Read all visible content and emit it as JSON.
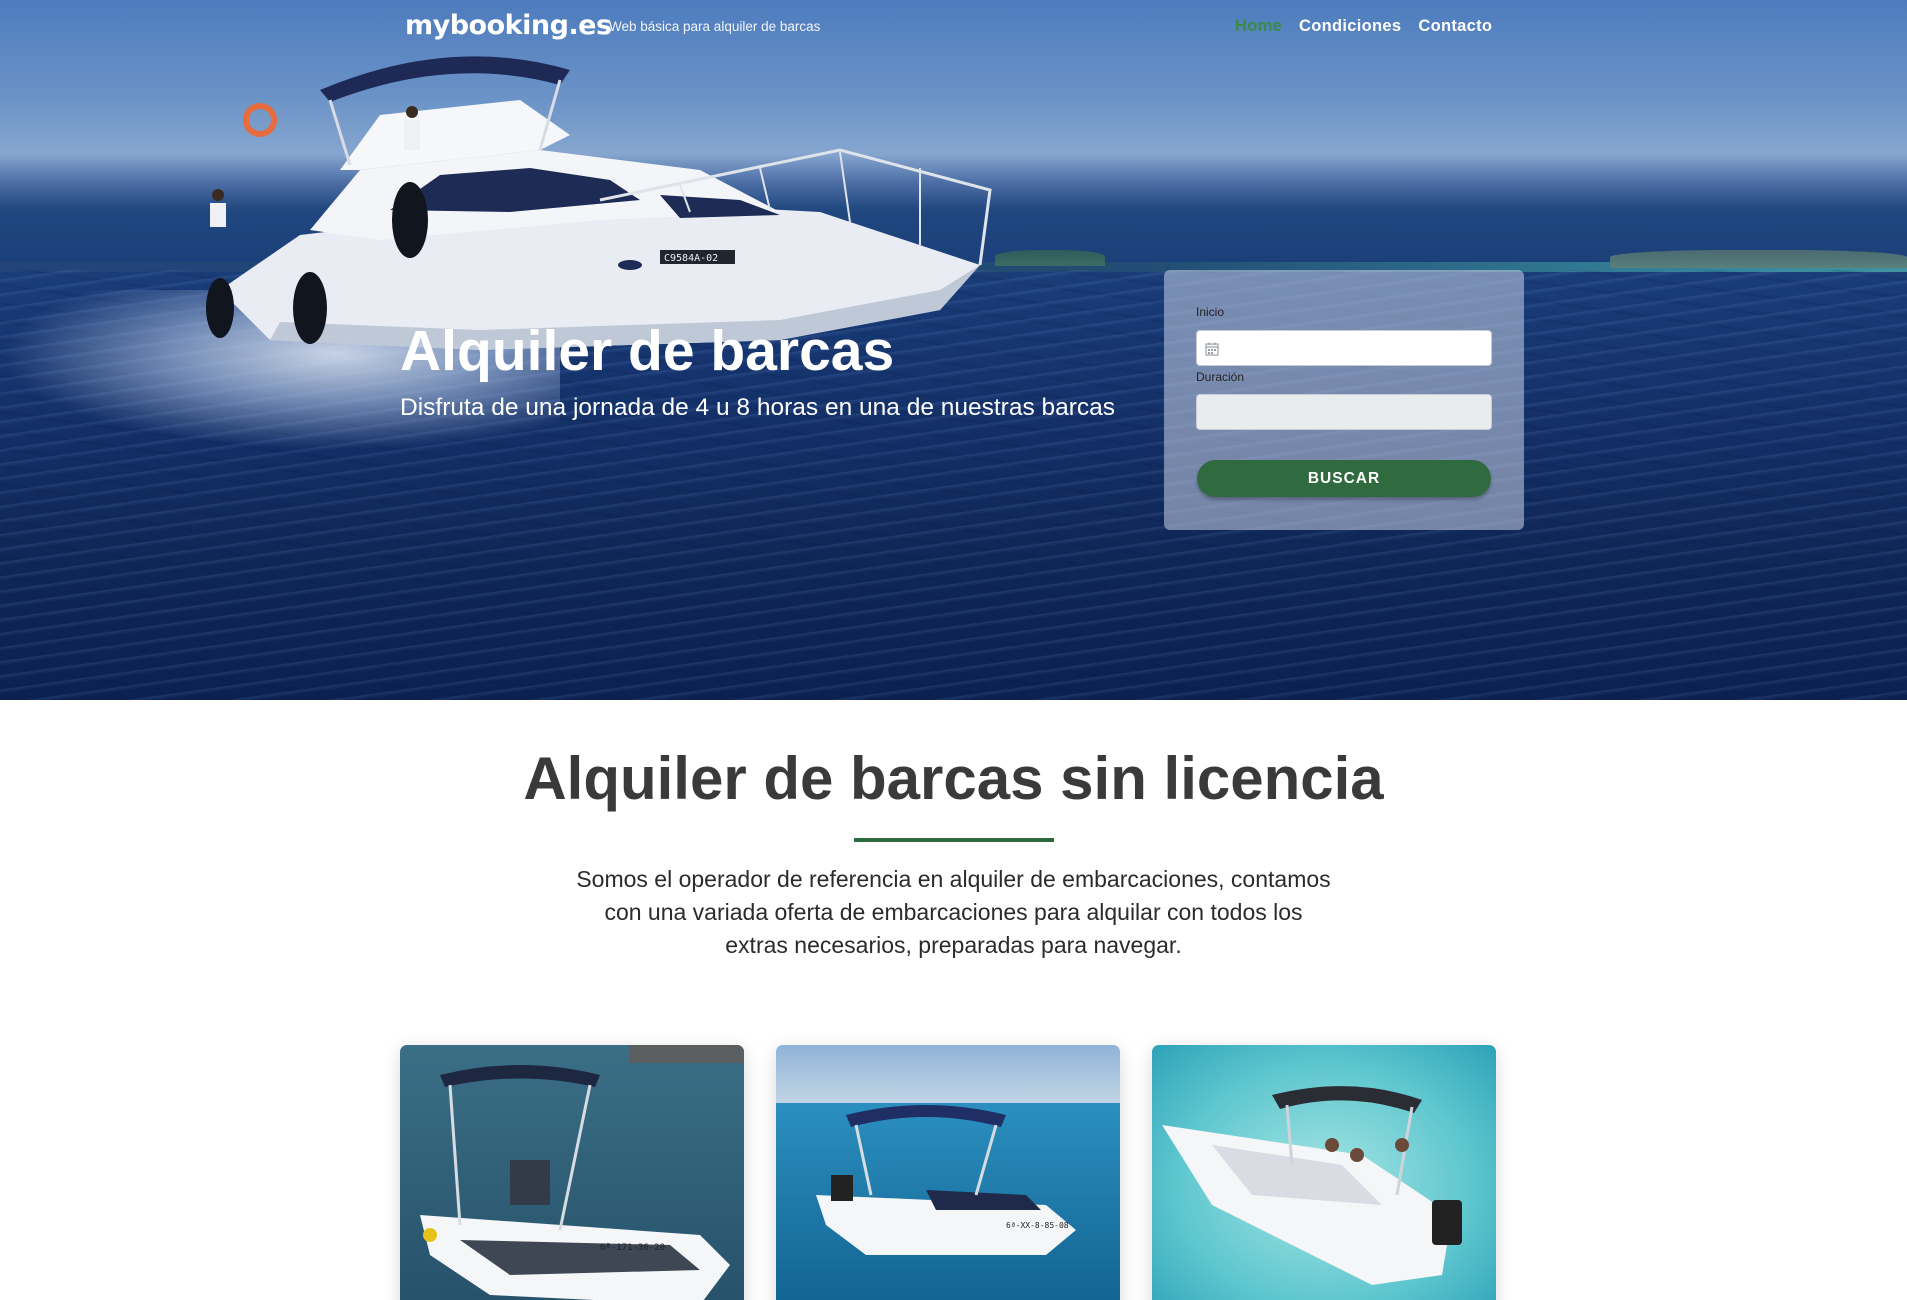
{
  "header": {
    "logo": "mybooking.es",
    "tagline": "Web básica para alquiler de barcas",
    "nav": [
      {
        "label": "Home",
        "active": true
      },
      {
        "label": "Condiciones",
        "active": false
      },
      {
        "label": "Contacto",
        "active": false
      }
    ],
    "active_color": "#3b8a47"
  },
  "hero": {
    "title": "Alquiler de barcas",
    "subtitle": "Disfruta de una jornada de 4 u 8 horas en una de nuestras barcas",
    "boat_registration": "C9584A-02"
  },
  "search": {
    "start_label": "Inicio",
    "start_value": "",
    "duration_label": "Duración",
    "duration_value": "",
    "button_label": "BUSCAR",
    "button_color": "#2f6b3e"
  },
  "intro": {
    "title": "Alquiler de barcas sin licencia",
    "text": "Somos el operador de referencia en alquiler de embarcaciones, contamos con una variada oferta de embarcaciones para alquilar con todos los extras necesarios, preparadas para navegar.",
    "divider_color": "#2f6b3e"
  },
  "boats": [
    {
      "image": "boat-photo-1",
      "registration": "6ª-171-36-20"
    },
    {
      "image": "boat-photo-2",
      "registration": "6ª-XX-8-85-08"
    },
    {
      "image": "boat-photo-3",
      "registration": ""
    }
  ]
}
